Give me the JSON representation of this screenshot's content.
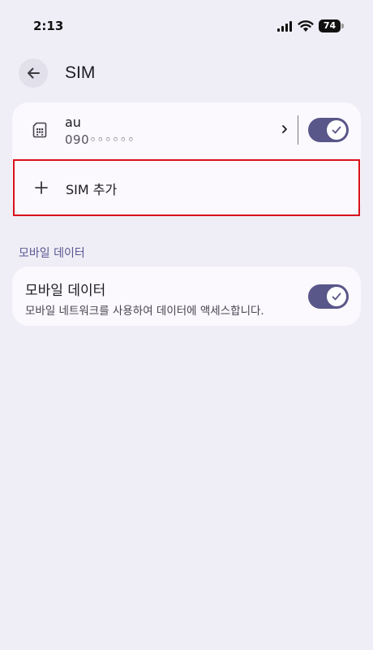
{
  "status_bar": {
    "time": "2:13",
    "battery_level": "74"
  },
  "header": {
    "title": "SIM"
  },
  "sim_card": {
    "carrier": "au",
    "number": "090◦◦◦◦◦◦",
    "enabled": true,
    "add_label": "SIM 추가"
  },
  "mobile_data": {
    "section_title": "모바일 데이터",
    "title": "모바일 데이터",
    "description": "모바일 네트워크를 사용하여 데이터에 액세스합니다.",
    "enabled": true
  },
  "colors": {
    "background": "#efedf6",
    "card": "#fbf8fe",
    "accent": "#595689",
    "highlight_border": "#d9121b"
  }
}
